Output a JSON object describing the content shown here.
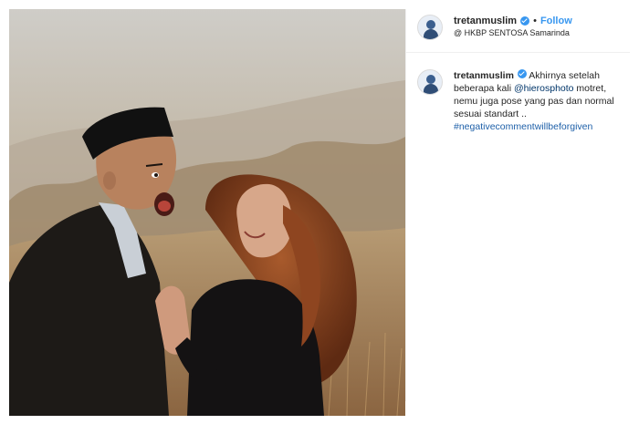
{
  "post": {
    "username": "tretanmuslim",
    "separator": "•",
    "follow_label": "Follow",
    "location": "@ HKBP SENTOSA Samarinda"
  },
  "caption": {
    "username": "tretanmuslim",
    "text_part1": " Akhirnya setelah beberapa kali ",
    "mention": "@hierosphoto",
    "text_part2": " motret, nemu juga pose yang pas dan normal sesuai standart ..",
    "hashtag": "#negativecommentwillbeforgiven"
  },
  "colors": {
    "link_blue": "#3897f0",
    "hashtag_blue": "#1d5fa8"
  },
  "icons": {
    "verified": "verified-badge-icon",
    "avatar": "profile-avatar-icon"
  }
}
